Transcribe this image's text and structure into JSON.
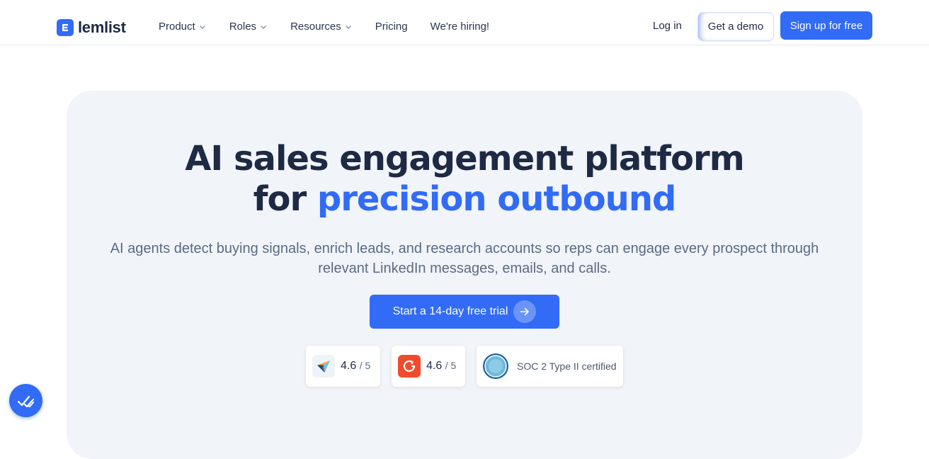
{
  "brand": {
    "name": "lemlist",
    "color": "#316bf6"
  },
  "nav": {
    "items": [
      {
        "label": "Product",
        "dropdown": true
      },
      {
        "label": "Roles",
        "dropdown": true
      },
      {
        "label": "Resources",
        "dropdown": true
      },
      {
        "label": "Pricing",
        "dropdown": false
      },
      {
        "label": "We're hiring!",
        "dropdown": false
      }
    ],
    "login_label": "Log in",
    "demo_label": "Get a demo",
    "signup_label": "Sign up for free"
  },
  "hero": {
    "headline_line1": "AI sales engagement platform",
    "headline_line2_prefix": "for ",
    "headline_line2_accent": "precision outbound",
    "subtext": "AI agents detect buying signals, enrich leads, and research accounts so reps can engage every prospect through relevant LinkedIn messages, emails, and calls.",
    "cta_label": "Start a 14-day free trial"
  },
  "badges": {
    "capterra": {
      "icon": "capterra-icon",
      "score": "4.6",
      "out_of": "/ 5"
    },
    "g2": {
      "icon": "g2-icon",
      "score": "4.6",
      "out_of": "/ 5"
    },
    "soc": {
      "icon": "aicpa-soc-icon",
      "label": "SOC 2 Type II certified",
      "seal_text": "AICPA SOC"
    }
  },
  "chat": {
    "icon": "chat-widget-icon"
  }
}
